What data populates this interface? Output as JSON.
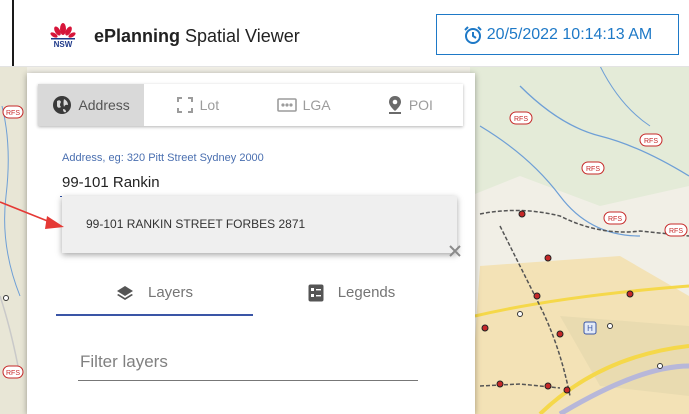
{
  "header": {
    "logo_text": "NSW",
    "title_bold": "ePlanning",
    "title_rest": " Spatial Viewer",
    "datetime": "20/5/2022 10:14:13 AM",
    "datetime_icon": "alarm-clock-icon"
  },
  "search_tabs": [
    {
      "label": "Address",
      "icon": "globe-icon",
      "active": true
    },
    {
      "label": "Lot",
      "icon": "crop-corners-icon",
      "active": false
    },
    {
      "label": "LGA",
      "icon": "dotted-box-icon",
      "active": false
    },
    {
      "label": "POI",
      "icon": "map-pin-icon",
      "active": false
    }
  ],
  "address": {
    "placeholder": "Address, eg: 320 Pitt Street Sydney 2000",
    "value": "99-101 Rankin"
  },
  "suggestions": [
    {
      "label": "99-101 RANKIN STREET FORBES 2871"
    }
  ],
  "layer_tabs": [
    {
      "label": "Layers",
      "icon": "layers-icon",
      "active": true
    },
    {
      "label": "Legends",
      "icon": "legend-list-icon",
      "active": false
    }
  ],
  "filter": {
    "placeholder": "Filter layers"
  },
  "map": {
    "markers": [
      "RFS",
      "RFS",
      "RFS",
      "RFS",
      "RFS",
      "RFS",
      "RFS",
      "H"
    ]
  },
  "colors": {
    "accent": "#1e79c7",
    "tab_indicator": "#3a55a6",
    "arrow": "#e53935",
    "rail_dot": "#d32f2f"
  }
}
